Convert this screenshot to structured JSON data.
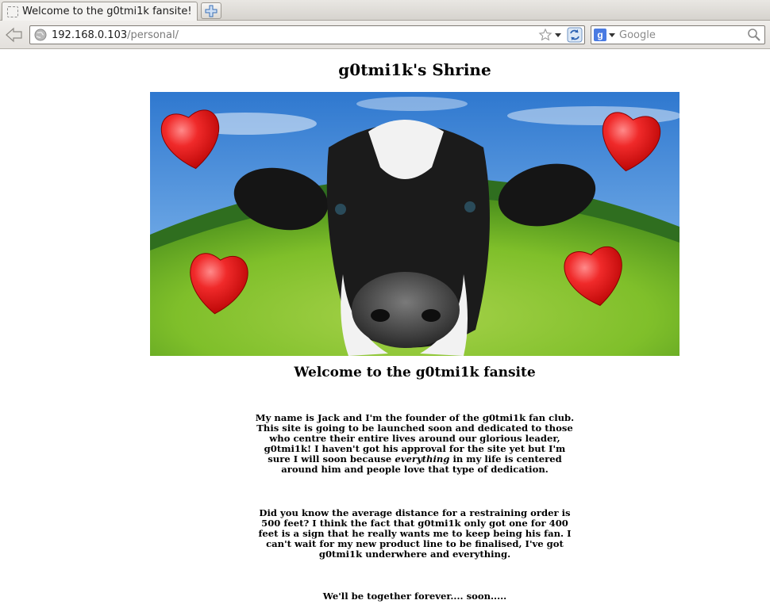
{
  "browser": {
    "tab_title": "Welcome to the g0tmi1k fansite!",
    "url_host": "192.168.0.103",
    "url_path": "/personal/",
    "search_placeholder": "Google",
    "search_engine_letter": "g"
  },
  "page": {
    "title": "g0tmi1k's Shrine",
    "subtitle": "Welcome to the g0tmi1k fansite",
    "paragraph1_before": "My name is Jack and I'm the founder of the g0tmi1k fan club. This site is going to be launched soon and dedicated to those who centre their entire lives around our glorious leader, g0tmi1k! I haven't got his approval for the site yet but I'm sure I will soon because ",
    "paragraph1_emphasis": "everything",
    "paragraph1_after": " in my life is centered around him and people love that type of dedication.",
    "paragraph2": "Did you know the average distance for a restraining order is 500 feet? I think the fact that g0tmi1k only got one for 400 feet is a sign that he really wants me to keep being his fan. I can't wait for my new product line to be finalised, I've got g0tmi1k underwhere and everything.",
    "paragraph3": "We'll be together forever.... soon....."
  },
  "colors": {
    "sky": "#3f86d8",
    "grass": "#7fbf2a",
    "heart": "#e8121a"
  }
}
